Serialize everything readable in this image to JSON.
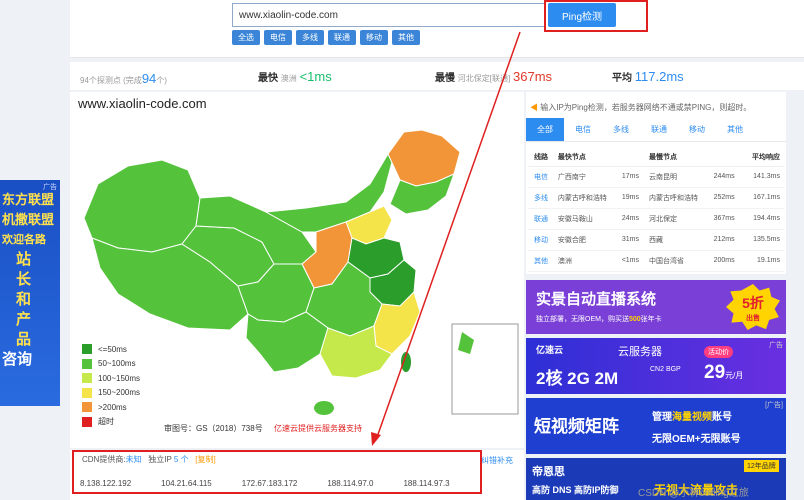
{
  "search": {
    "value": "www.xiaolin-code.com",
    "button": "Ping检测"
  },
  "isp_buttons": [
    "全选",
    "电信",
    "多线",
    "联通",
    "移动",
    "其他"
  ],
  "stats": {
    "probe_text": "94个探测点",
    "done_prefix": "(完成",
    "done_count": "94",
    "done_suffix": "个)",
    "fastest_label": "最快",
    "fastest_loc": "澳洲",
    "fastest_val": "<1ms",
    "slowest_label": "最慢",
    "slowest_loc": "河北保定[联通]",
    "slowest_val": "367ms",
    "avg_label": "平均",
    "avg_val": "117.2ms"
  },
  "map": {
    "site": "www.xiaolin-code.com",
    "legend": [
      {
        "label": "<=50ms",
        "color": "#2a9d2a"
      },
      {
        "label": "50~100ms",
        "color": "#55c23c"
      },
      {
        "label": "100~150ms",
        "color": "#c5e84a"
      },
      {
        "label": "150~200ms",
        "color": "#f5e34a"
      },
      {
        "label": ">200ms",
        "color": "#f29538"
      },
      {
        "label": "超时",
        "color": "#e02020"
      }
    ],
    "map_no": "审图号：GS（2018）738号",
    "provider": "亿速云提供云服务器支持"
  },
  "cdn": {
    "label": "CDN提供商:",
    "provider": "未知",
    "ip_label": "独立IP",
    "ip_count": "5 个",
    "copy": "[复制]",
    "ips": [
      "8.138.122.192",
      "104.21.64.115",
      "172.67.183.172",
      "188.114.97.0",
      "188.114.97.3"
    ],
    "feedback": "纠错补充"
  },
  "right": {
    "tip": "输入IP为Ping检测，若服务器网络不通或禁PING，则超时。",
    "tabs": [
      "全部",
      "电信",
      "多线",
      "联通",
      "移动",
      "其他"
    ],
    "headers": [
      "线路",
      "最快节点",
      "",
      "最慢节点",
      "",
      "平均响应"
    ],
    "rows": [
      {
        "line": "电信",
        "fast": "广西南宁",
        "fast_ms": "17ms",
        "slow": "云南昆明",
        "slow_ms": "244ms",
        "avg": "141.3ms"
      },
      {
        "line": "多线",
        "fast": "内蒙古呼和浩特",
        "fast_ms": "19ms",
        "slow": "内蒙古呼和浩特",
        "slow_ms": "252ms",
        "avg": "167.1ms"
      },
      {
        "line": "联通",
        "fast": "安徽马鞍山",
        "fast_ms": "24ms",
        "slow": "河北保定",
        "slow_ms": "367ms",
        "avg": "194.4ms"
      },
      {
        "line": "移动",
        "fast": "安徽合肥",
        "fast_ms": "31ms",
        "slow": "西藏",
        "slow_ms": "212ms",
        "avg": "135.5ms"
      },
      {
        "line": "其他",
        "fast": "澳洲",
        "fast_ms": "<1ms",
        "slow": "中国台湾省",
        "slow_ms": "200ms",
        "avg": "19.1ms"
      }
    ]
  },
  "ads": {
    "tag": "广告",
    "tag2": "[广告]",
    "a1_title": "实景自动直播系统",
    "a1_sub": "独立部署，无限OEM，购买送",
    "a1_sub_hl": "500",
    "a1_sub_end": "张年卡",
    "a1_badge": "5折",
    "a1_badge_sub": "出售",
    "a2_brand": "亿速云",
    "a2_title": "云服务器",
    "a2_spec": "2核 2G 2M",
    "a2_line": "CN2 BGP",
    "a2_promo": "活动价",
    "a2_price": "29",
    "a2_unit": "元/月",
    "a3_title": "短视频矩阵",
    "a3_line1_pre": "管理",
    "a3_line1_hl": "海量视频",
    "a3_line1_end": "账号",
    "a3_line2": "无限OEM+无限账号",
    "a4_brand": "帝恩思",
    "a4_years": "12年品牌",
    "a4_text": "高防 DNS 高防IP防御",
    "a4_slogan": "无视大流量攻击",
    "left_lines": [
      "东方联盟",
      "机撒联盟",
      "欢迎各路",
      "站",
      "长",
      "和",
      "产",
      "品",
      "咨询"
    ]
  },
  "watermark": "CSDN @小林coding之旅"
}
